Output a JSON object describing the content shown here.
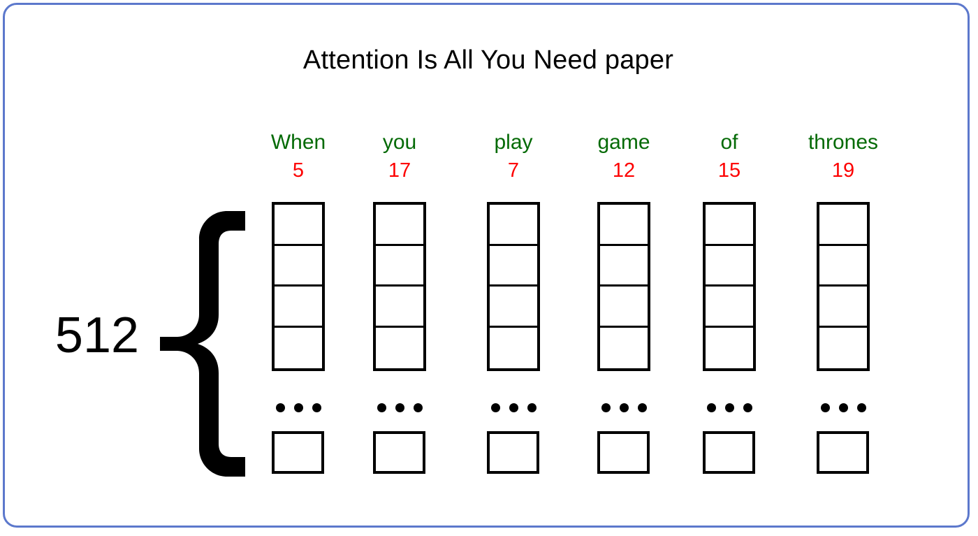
{
  "figure": {
    "title": "Attention Is All You Need paper",
    "dimension_label": "512",
    "brace_glyph": "{",
    "ellipsis_dot_count": 3,
    "cells_per_visible_stack": 4,
    "colors": {
      "border": "#5c78cc",
      "word": "#046a06",
      "token_id": "#fd0000",
      "cell_outline": "#000000",
      "text": "#000000",
      "background": "#ffffff"
    }
  },
  "columns": [
    {
      "word": "When",
      "token_id": "5"
    },
    {
      "word": "you",
      "token_id": "17"
    },
    {
      "word": "play",
      "token_id": "7"
    },
    {
      "word": "game",
      "token_id": "12"
    },
    {
      "word": "of",
      "token_id": "15"
    },
    {
      "word": "thrones",
      "token_id": "19"
    }
  ]
}
